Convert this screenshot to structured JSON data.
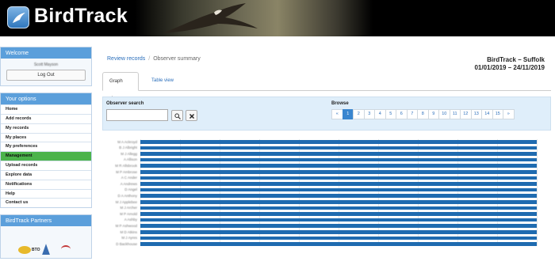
{
  "header": {
    "logo_text": "BirdTrack"
  },
  "welcome": {
    "title": "Welcome",
    "user": "Scott Mayson",
    "logout": "Log Out"
  },
  "options": {
    "title": "Your options",
    "items": [
      "Home",
      "Add records",
      "My records",
      "My places",
      "My preferences",
      "Management",
      "Upload records",
      "Explore data",
      "Notifications",
      "Help",
      "Contact us"
    ],
    "active": "Management"
  },
  "partners": {
    "title": "BirdTrack Partners",
    "bto": "BTO"
  },
  "breadcrumb": {
    "link": "Review records",
    "separator": "/",
    "current": "Observer summary"
  },
  "region": {
    "title": "BirdTrack – Suffolk",
    "dates": "01/01/2019 – 24/11/2019"
  },
  "tabs": {
    "graph": "Graph view",
    "table": "Table view"
  },
  "search": {
    "label": "Observer search",
    "placeholder": ""
  },
  "browse": {
    "label": "Browse",
    "prev": "«",
    "next": "»",
    "pages": [
      "1",
      "2",
      "3",
      "4",
      "5",
      "6",
      "7",
      "8",
      "9",
      "10",
      "11",
      "12",
      "13",
      "14",
      "15"
    ],
    "active_page": "1"
  },
  "chart_data": {
    "type": "bar",
    "orientation": "horizontal",
    "categories": [
      "M A Ackroyd",
      "B J Albright",
      "M J Allegg",
      "A Allison",
      "M R Allsbrook",
      "M P Ambrose",
      "A C Ander",
      "A Andrews",
      "D Angel",
      "D A Anthony",
      "M J Applebee",
      "M J Archer",
      "M P Arnold",
      "A Ashby",
      "M P Ashwood",
      "M D Atkins",
      "M J Ayres",
      "D Backhouse"
    ],
    "values": [
      100,
      100,
      100,
      100,
      100,
      100,
      100,
      100,
      100,
      100,
      100,
      100,
      100,
      100,
      100,
      100,
      100,
      100
    ],
    "grid": true
  }
}
